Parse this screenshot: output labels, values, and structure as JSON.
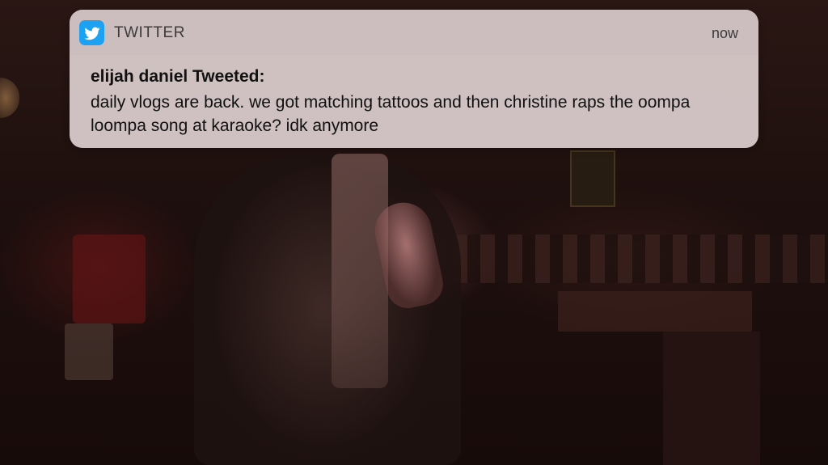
{
  "notification": {
    "app_icon": "twitter-bird-icon",
    "app_name": "TWITTER",
    "time": "now",
    "title": "elijah daniel Tweeted:",
    "body": "daily vlogs are back. we got matching tattoos and then christine raps the oompa loompa song at karaoke? idk anymore"
  },
  "colors": {
    "twitter_blue": "#1da1f2",
    "banner_bg": "#ded0d0",
    "background_dark": "#1d0f0d"
  }
}
